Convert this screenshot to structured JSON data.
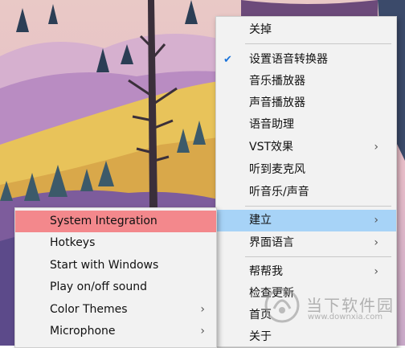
{
  "main_menu": {
    "items": [
      {
        "label": "关掉",
        "checked": false,
        "submenu": false
      },
      {
        "label": "设置语音转换器",
        "checked": true,
        "submenu": false
      },
      {
        "label": "音乐播放器",
        "checked": false,
        "submenu": false
      },
      {
        "label": "声音播放器",
        "checked": false,
        "submenu": false
      },
      {
        "label": "语音助理",
        "checked": false,
        "submenu": false
      },
      {
        "label": "VST效果",
        "checked": false,
        "submenu": true
      },
      {
        "label": "听到麦克风",
        "checked": false,
        "submenu": false
      },
      {
        "label": "听音乐/声音",
        "checked": false,
        "submenu": false
      },
      {
        "label": "建立",
        "checked": false,
        "submenu": true,
        "highlighted": true
      },
      {
        "label": "界面语言",
        "checked": false,
        "submenu": true
      },
      {
        "label": "帮帮我",
        "checked": false,
        "submenu": true
      },
      {
        "label": "检查更新",
        "checked": false,
        "submenu": false
      },
      {
        "label": "首页",
        "checked": false,
        "submenu": false
      },
      {
        "label": "关于",
        "checked": false,
        "submenu": false
      }
    ],
    "check_glyph": "✔",
    "chevron_glyph": "›"
  },
  "sub_menu": {
    "items": [
      {
        "label": "System Integration",
        "submenu": false,
        "highlighted": true
      },
      {
        "label": "Hotkeys",
        "submenu": false
      },
      {
        "label": "Start with Windows",
        "submenu": false
      },
      {
        "label": "Play on/off sound",
        "submenu": false
      },
      {
        "label": "Color Themes",
        "submenu": true
      },
      {
        "label": "Microphone",
        "submenu": true
      }
    ]
  },
  "watermark": {
    "text": "当下软件园",
    "url": "www.downxia.com"
  },
  "colors": {
    "menu_bg": "#f2f2f2",
    "main_highlight": "#a7d3f7",
    "sub_highlight": "#f3888c",
    "check_blue": "#1a73d9"
  }
}
